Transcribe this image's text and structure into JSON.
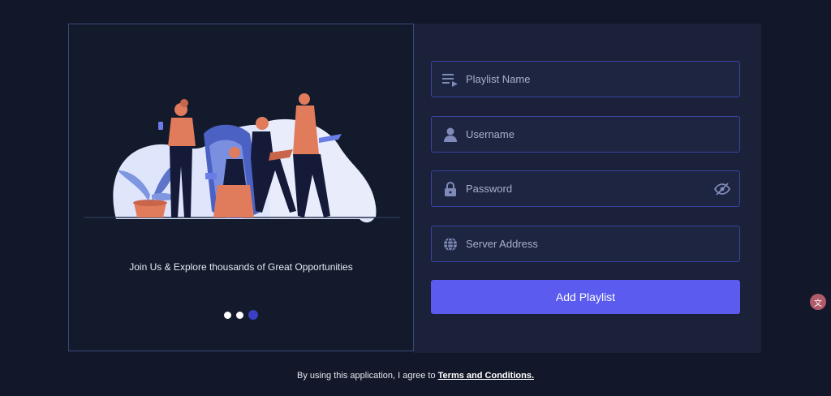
{
  "hero": {
    "tagline": "Join Us & Explore thousands of Great Opportunities",
    "carousel": {
      "slides": 3,
      "active_index": 2
    }
  },
  "form": {
    "playlist_name": {
      "placeholder": "Playlist Name",
      "value": "",
      "icon": "playlist-icon"
    },
    "username": {
      "placeholder": "Username",
      "value": "",
      "icon": "user-icon"
    },
    "password": {
      "placeholder": "Password",
      "value": "",
      "icon": "lock-icon",
      "toggle_icon": "eye-slash-icon"
    },
    "server_address": {
      "placeholder": "Server Address",
      "value": "",
      "icon": "globe-icon"
    },
    "submit_label": "Add Playlist"
  },
  "footer": {
    "prefix": "By using this application, I agree to",
    "link_text": "Terms and Conditions."
  },
  "colors": {
    "background": "#121829",
    "panel": "#1a2139",
    "accent": "#5b5bf0",
    "field_border": "#3b43a3"
  }
}
